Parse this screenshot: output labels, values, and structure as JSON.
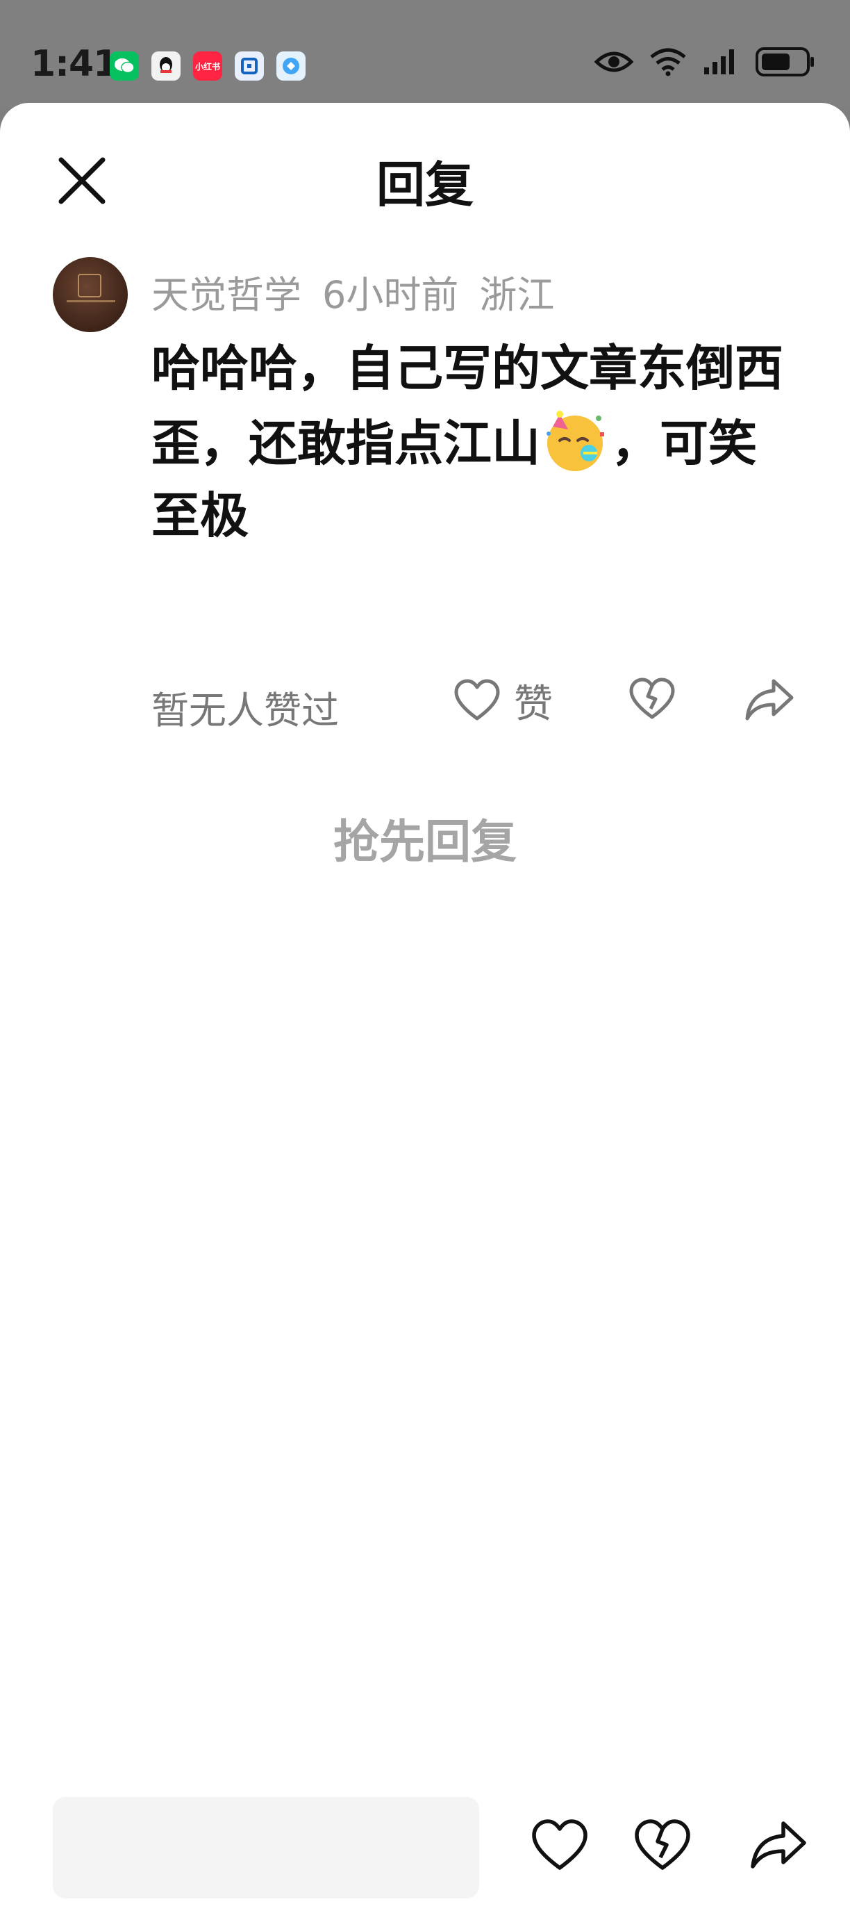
{
  "status_bar": {
    "time": "1:41",
    "notifications": [
      "wechat-icon",
      "qq-icon",
      "xiaohongshu-icon",
      "bank-icon",
      "browser-icon"
    ],
    "xiaohongshu_label": "小红书"
  },
  "header": {
    "title": "回复",
    "close_icon": "close-icon"
  },
  "comment": {
    "author": "天觉哲学",
    "time_ago": "6小时前",
    "location": "浙江",
    "text_before_emoji": "哈哈哈，自己写的文章东倒西歪，还敢指点江山",
    "text_after_emoji": "，可笑至极",
    "emoji": "partying-face-emoji",
    "likes_text": "暂无人赞过",
    "like_label": "赞"
  },
  "replies": {
    "empty_prompt": "抢先回复"
  },
  "bottom_bar": {
    "input_placeholder": ""
  },
  "colors": {
    "background": "#ffffff",
    "overlay": "#808080",
    "text": "#111111",
    "secondary_text": "#9a9a9a",
    "input_bg": "#f4f4f4"
  }
}
